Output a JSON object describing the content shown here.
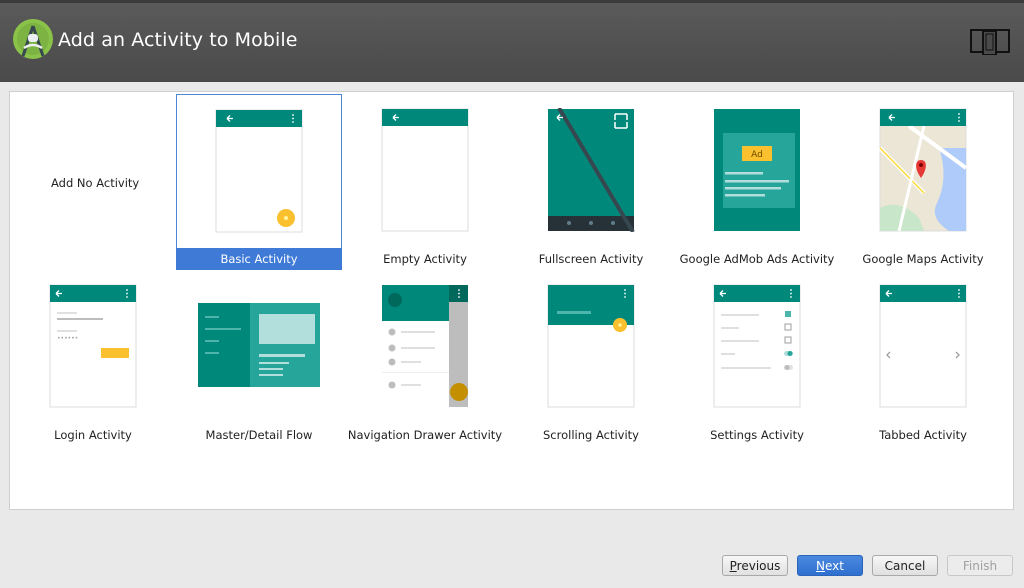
{
  "window": {
    "title": "Add an Activity to Mobile"
  },
  "colors": {
    "teal": "#00897b",
    "teal_light": "#26a69a",
    "selection": "#3f7ad7",
    "fab": "#fbc02d"
  },
  "activities": {
    "none": "Add No Activity",
    "items": [
      {
        "label": "Basic Activity",
        "icon": "basic-activity-thumbnail",
        "selected": true
      },
      {
        "label": "Empty Activity",
        "icon": "empty-activity-thumbnail"
      },
      {
        "label": "Fullscreen Activity",
        "icon": "fullscreen-activity-thumbnail"
      },
      {
        "label": "Google AdMob Ads Activity",
        "icon": "admob-activity-thumbnail",
        "ad_label": "Ad"
      },
      {
        "label": "Google Maps Activity",
        "icon": "maps-activity-thumbnail"
      },
      {
        "label": "Login Activity",
        "icon": "login-activity-thumbnail"
      },
      {
        "label": "Master/Detail Flow",
        "icon": "master-detail-thumbnail"
      },
      {
        "label": "Navigation Drawer Activity",
        "icon": "nav-drawer-thumbnail"
      },
      {
        "label": "Scrolling Activity",
        "icon": "scrolling-activity-thumbnail"
      },
      {
        "label": "Settings Activity",
        "icon": "settings-activity-thumbnail"
      },
      {
        "label": "Tabbed Activity",
        "icon": "tabbed-activity-thumbnail"
      }
    ]
  },
  "buttons": {
    "previous_u": "P",
    "previous_rest": "revious",
    "next_u": "N",
    "next_rest": "ext",
    "cancel": "Cancel",
    "finish": "Finish"
  }
}
